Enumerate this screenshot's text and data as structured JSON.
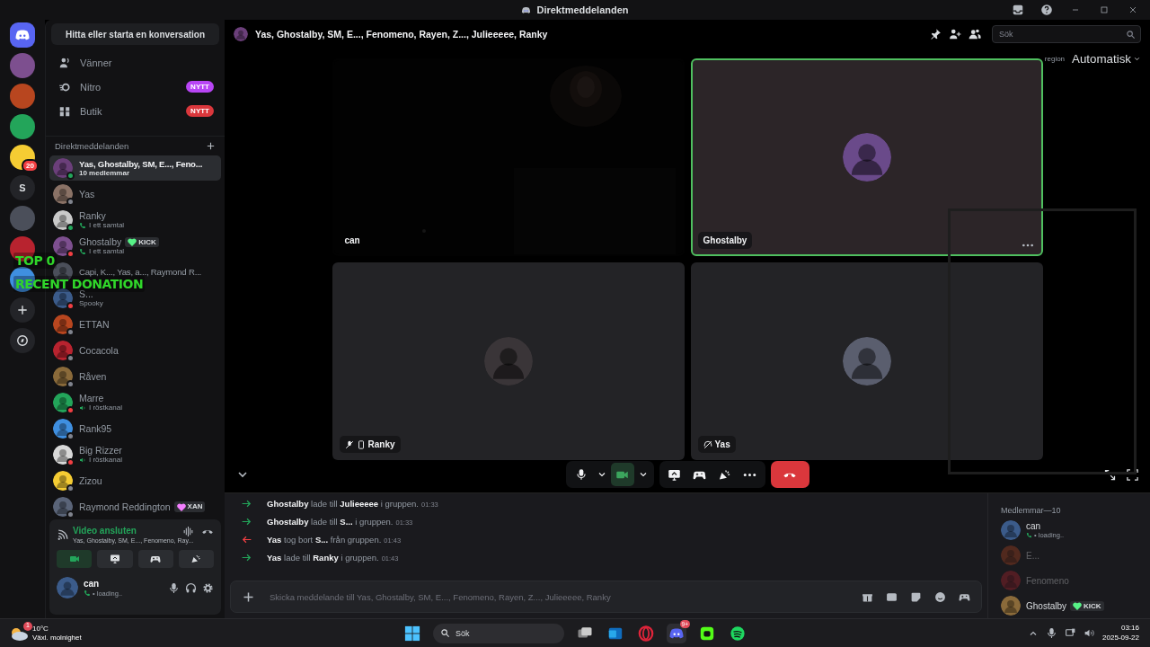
{
  "window": {
    "title": "Direktmeddelanden"
  },
  "servers": [
    {
      "kind": "home"
    },
    {
      "kind": "avatar"
    },
    {
      "kind": "avatar"
    },
    {
      "kind": "avatar"
    },
    {
      "kind": "avatar",
      "badge": "20"
    },
    {
      "kind": "text",
      "label": "S"
    },
    {
      "kind": "avatar"
    },
    {
      "kind": "avatar"
    },
    {
      "kind": "avatar"
    },
    {
      "kind": "add"
    },
    {
      "kind": "discover"
    }
  ],
  "sidebar": {
    "search": "Hitta eller starta en konversation",
    "nav": [
      {
        "kind": "friends",
        "label": "Vänner"
      },
      {
        "kind": "nitro",
        "label": "Nitro",
        "badge": {
          "text": "NYTT",
          "color": "#b845f5"
        }
      },
      {
        "kind": "shop",
        "label": "Butik",
        "badge": {
          "text": "NYTT",
          "color": "#da373c"
        }
      }
    ],
    "dm_header": "Direktmeddelanden",
    "dms": [
      {
        "name": "Yas, Ghostalby, SM, E..., Feno...",
        "subtitle": {
          "kind": "plain",
          "text": "10 medlemmar"
        },
        "color": "#23a55a",
        "selected": true
      },
      {
        "name": "Yas",
        "color": "#80848e",
        "selected": false
      },
      {
        "name": "Ranky",
        "subtitle": {
          "kind": "call",
          "text": "I ett samtal"
        },
        "color": "#23a55a",
        "selected": false
      },
      {
        "name": "Ghostalby",
        "tag": {
          "text": "KICK",
          "color": "#57f287"
        },
        "subtitle": {
          "kind": "call",
          "text": "I ett samtal"
        },
        "color": "#f23f43",
        "selected": false
      },
      {
        "name": "Capi, K..., Yas, a..., Raymond R...",
        "selected": false
      },
      {
        "name": "S...",
        "subtitle": {
          "kind": "plain",
          "text": "Spooky"
        },
        "color": "#f23f43",
        "selected": false
      },
      {
        "name": "ETTAN",
        "color": "#80848e",
        "selected": false
      },
      {
        "name": "Cocacola",
        "color": "#80848e",
        "selected": false
      },
      {
        "name": "Råven",
        "color": "#80848e",
        "selected": false
      },
      {
        "name": "Marre",
        "subtitle": {
          "kind": "voice",
          "text": "I röstkanal"
        },
        "color": "#f23f43",
        "selected": false
      },
      {
        "name": "Rank95",
        "color": "#80848e",
        "selected": false
      },
      {
        "name": "Big Rizzer",
        "subtitle": {
          "kind": "voice",
          "text": "I röstkanal"
        },
        "color": "#f23f43",
        "selected": false
      },
      {
        "name": "Zizou",
        "color": "#80848e",
        "selected": false
      },
      {
        "name": "Raymond Reddington",
        "tag": {
          "text": "XAN",
          "color": "#f47fff"
        },
        "color": "#80848e",
        "selected": false
      }
    ],
    "voice": {
      "status": "Video ansluten",
      "channel": "Yas, Ghostalby, SM, E..., Fenomeno, Ray...",
      "buttons": [
        {
          "kind": "camera",
          "selected": true
        },
        {
          "kind": "screen",
          "selected": false
        },
        {
          "kind": "activity",
          "selected": false
        },
        {
          "kind": "soundboard",
          "selected": false
        }
      ]
    },
    "user": {
      "name": "can",
      "status": "• loading.."
    }
  },
  "header": {
    "title": "Yas, Ghostalby, SM, E..., Fenomeno, Rayen, Z..., Julieeeee, Ranky",
    "search_placeholder": "Sök"
  },
  "stage": {
    "region_label": "region",
    "region_value": "Automatisk",
    "tiles": [
      {
        "name": "can",
        "kind": "video",
        "speaking": false,
        "muted": false,
        "mobile": false,
        "deafened": false,
        "menu": false
      },
      {
        "name": "Ghostalby",
        "kind": "avatar",
        "speaking": true,
        "muted": false,
        "mobile": false,
        "deafened": false,
        "menu": true
      },
      {
        "name": "Ranky",
        "kind": "avatar",
        "speaking": false,
        "muted": true,
        "mobile": true,
        "deafened": false,
        "menu": false
      },
      {
        "name": "Yas",
        "kind": "avatar",
        "speaking": false,
        "muted": false,
        "mobile": false,
        "deafened": true,
        "menu": false
      }
    ],
    "controls": {
      "mic_on": true,
      "camera_on": true
    }
  },
  "messages": [
    {
      "kind": "added",
      "text": "**Ghostalby** lade till **Julieeeee** i gruppen.",
      "time": "01:33"
    },
    {
      "kind": "added",
      "text": "**Ghostalby** lade till **S...** i gruppen.",
      "time": "01:33"
    },
    {
      "kind": "removed",
      "text": "**Yas** tog bort **S...** från gruppen.",
      "time": "01:43"
    },
    {
      "kind": "added",
      "text": "**Yas** lade till **Ranky** i gruppen.",
      "time": "01:43"
    }
  ],
  "composer": {
    "placeholder": "Skicka meddelande till Yas, Ghostalby, SM, E..., Fenomeno, Rayen, Z..., Julieeeee, Ranky"
  },
  "members": {
    "title": "Medlemmar—10",
    "items": [
      {
        "name": "can",
        "status": "• loading..",
        "offline": false
      },
      {
        "name": "E...",
        "offline": true
      },
      {
        "name": "Fenomeno",
        "offline": true
      },
      {
        "name": "Ghostalby",
        "tag": {
          "text": "KICK",
          "color": "#57f287"
        },
        "offline": false
      }
    ]
  },
  "stream_overlay": {
    "lines": [
      "TOP 0",
      "RECENT DONATION"
    ]
  },
  "taskbar": {
    "weather": {
      "temp": "10°C",
      "text": "Växl. molnighet",
      "badge": "1"
    },
    "search": "Sök",
    "discord_badge": "9+",
    "time": "03:16",
    "date": "2025-09-22"
  }
}
